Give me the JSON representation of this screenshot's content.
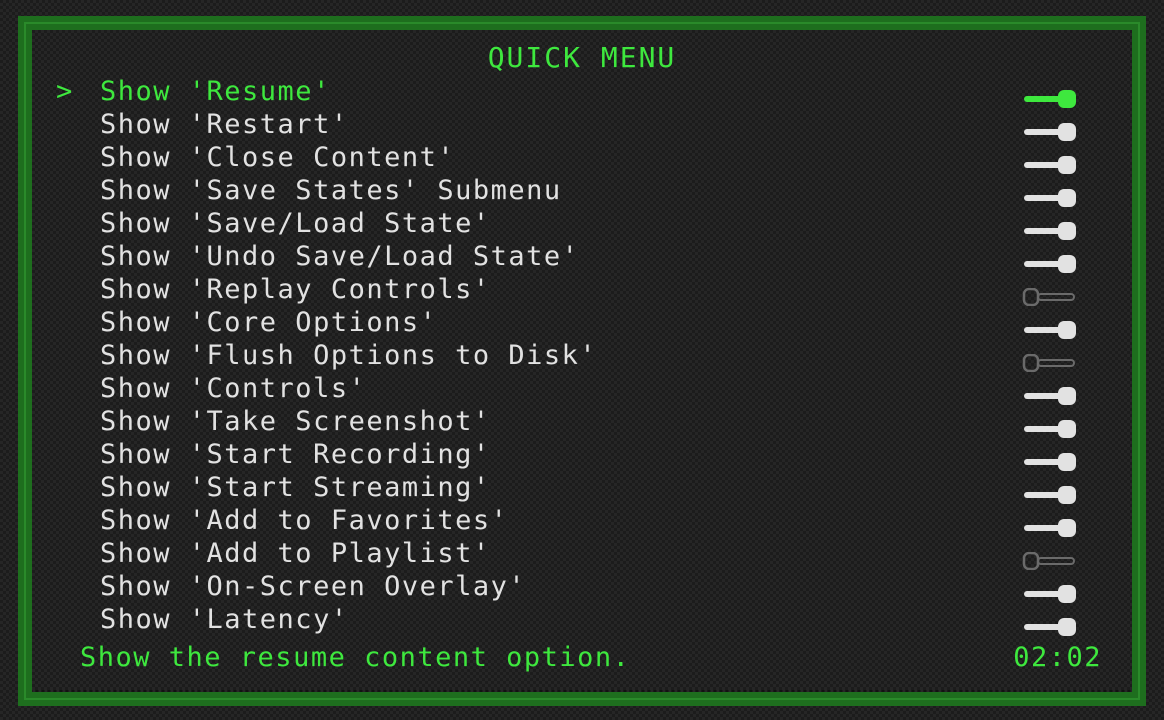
{
  "menu": {
    "title": "QUICK MENU",
    "cursor": ">",
    "selected_index": 0,
    "items": [
      {
        "label": "Show 'Resume'",
        "enabled": true
      },
      {
        "label": "Show 'Restart'",
        "enabled": true
      },
      {
        "label": "Show 'Close Content'",
        "enabled": true
      },
      {
        "label": "Show 'Save States' Submenu",
        "enabled": true
      },
      {
        "label": "Show 'Save/Load State'",
        "enabled": true
      },
      {
        "label": "Show 'Undo Save/Load State'",
        "enabled": true
      },
      {
        "label": "Show 'Replay Controls'",
        "enabled": false
      },
      {
        "label": "Show 'Core Options'",
        "enabled": true
      },
      {
        "label": "Show 'Flush Options to Disk'",
        "enabled": false
      },
      {
        "label": "Show 'Controls'",
        "enabled": true
      },
      {
        "label": "Show 'Take Screenshot'",
        "enabled": true
      },
      {
        "label": "Show 'Start Recording'",
        "enabled": true
      },
      {
        "label": "Show 'Start Streaming'",
        "enabled": true
      },
      {
        "label": "Show 'Add to Favorites'",
        "enabled": true
      },
      {
        "label": "Show 'Add to Playlist'",
        "enabled": false
      },
      {
        "label": "Show 'On-Screen Overlay'",
        "enabled": true
      },
      {
        "label": "Show 'Latency'",
        "enabled": true
      }
    ]
  },
  "footer": {
    "help_text": "Show the resume content option.",
    "clock": "02:02"
  },
  "theme": {
    "accent_green": "#3ee83e",
    "text_white": "#e2e2e2",
    "toggle_off_gray": "#6a6a6a",
    "frame_green": "#1e6e1e"
  },
  "icons": {
    "toggle_on": "toggle-on-icon",
    "toggle_off": "toggle-off-icon"
  }
}
